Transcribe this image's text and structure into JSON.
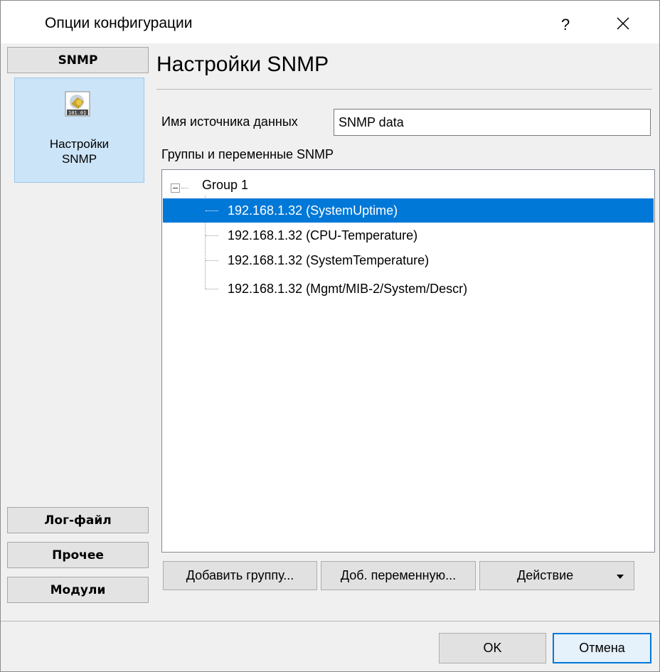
{
  "window": {
    "title": "Опции конфигурации",
    "help_label": "?",
    "close_label": "✕"
  },
  "sidebar": {
    "sections": [
      {
        "label": "SNMP",
        "active": true
      },
      {
        "label": "Лог-файл"
      },
      {
        "label": "Прочее"
      },
      {
        "label": "Модули"
      }
    ],
    "items": [
      {
        "label_line1": "Настройки",
        "label_line2": "SNMP",
        "icon": "snmp-settings-icon",
        "selected": true
      }
    ]
  },
  "page": {
    "title": "Настройки SNMP",
    "datasource_label": "Имя источника данных",
    "datasource_value": "SNMP data",
    "groups_label": "Группы и переменные SNMP"
  },
  "tree": {
    "group": {
      "label": "Group 1",
      "expanded": true
    },
    "variables": [
      {
        "label": "192.168.1.32 (SystemUptime)",
        "selected": true
      },
      {
        "label": "192.168.1.32 (CPU-Temperature)"
      },
      {
        "label": "192.168.1.32 (SystemTemperature)"
      },
      {
        "label": "192.168.1.32 (Mgmt/MIB-2/System/Descr)"
      }
    ]
  },
  "buttons": {
    "add_group": "Добавить группу...",
    "add_variable": "Доб. переменную...",
    "action": "Действие",
    "ok": "OK",
    "cancel": "Отмена"
  },
  "colors": {
    "selection": "#0078d7",
    "sidebar_selected_bg": "#cce4f7",
    "window_bg": "#f0f0f0"
  }
}
